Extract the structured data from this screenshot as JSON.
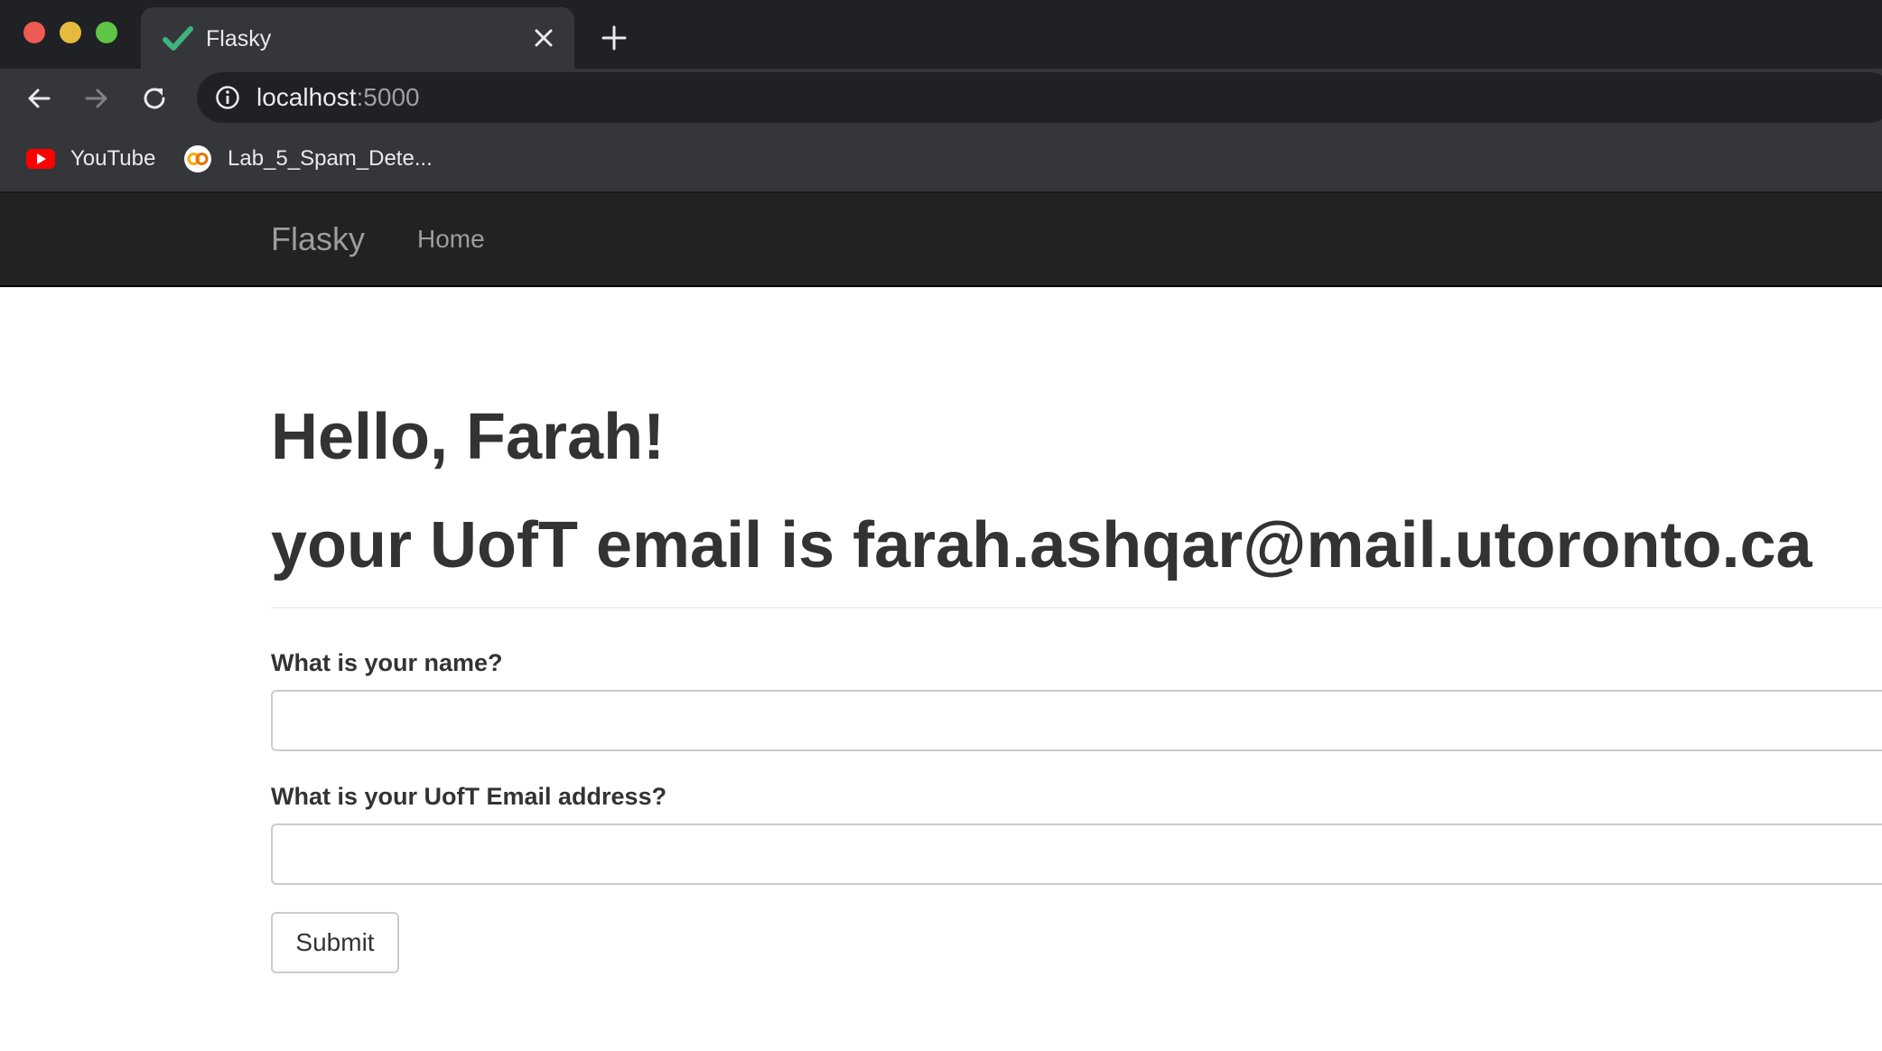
{
  "browser": {
    "tab": {
      "title": "Flasky",
      "favicon": "green-check-icon"
    },
    "address": {
      "host": "localhost",
      "port": ":5000"
    },
    "bookmarks": [
      {
        "label": "YouTube",
        "icon": "youtube-icon"
      },
      {
        "label": "Lab_5_Spam_Dete...",
        "icon": "colab-icon"
      }
    ]
  },
  "navbar": {
    "brand": "Flasky",
    "home": "Home"
  },
  "main": {
    "greeting": "Hello, Farah!",
    "email_line": "your UofT email is farah.ashqar@mail.utoronto.ca",
    "form": {
      "name_label": "What is your name?",
      "name_value": "",
      "email_label": "What is your UofT Email address?",
      "email_value": "",
      "submit_label": "Submit"
    }
  },
  "colors": {
    "navbar_bg": "#222222",
    "text": "#333333",
    "chrome_dark": "#202124",
    "chrome_mid": "#35363a"
  }
}
